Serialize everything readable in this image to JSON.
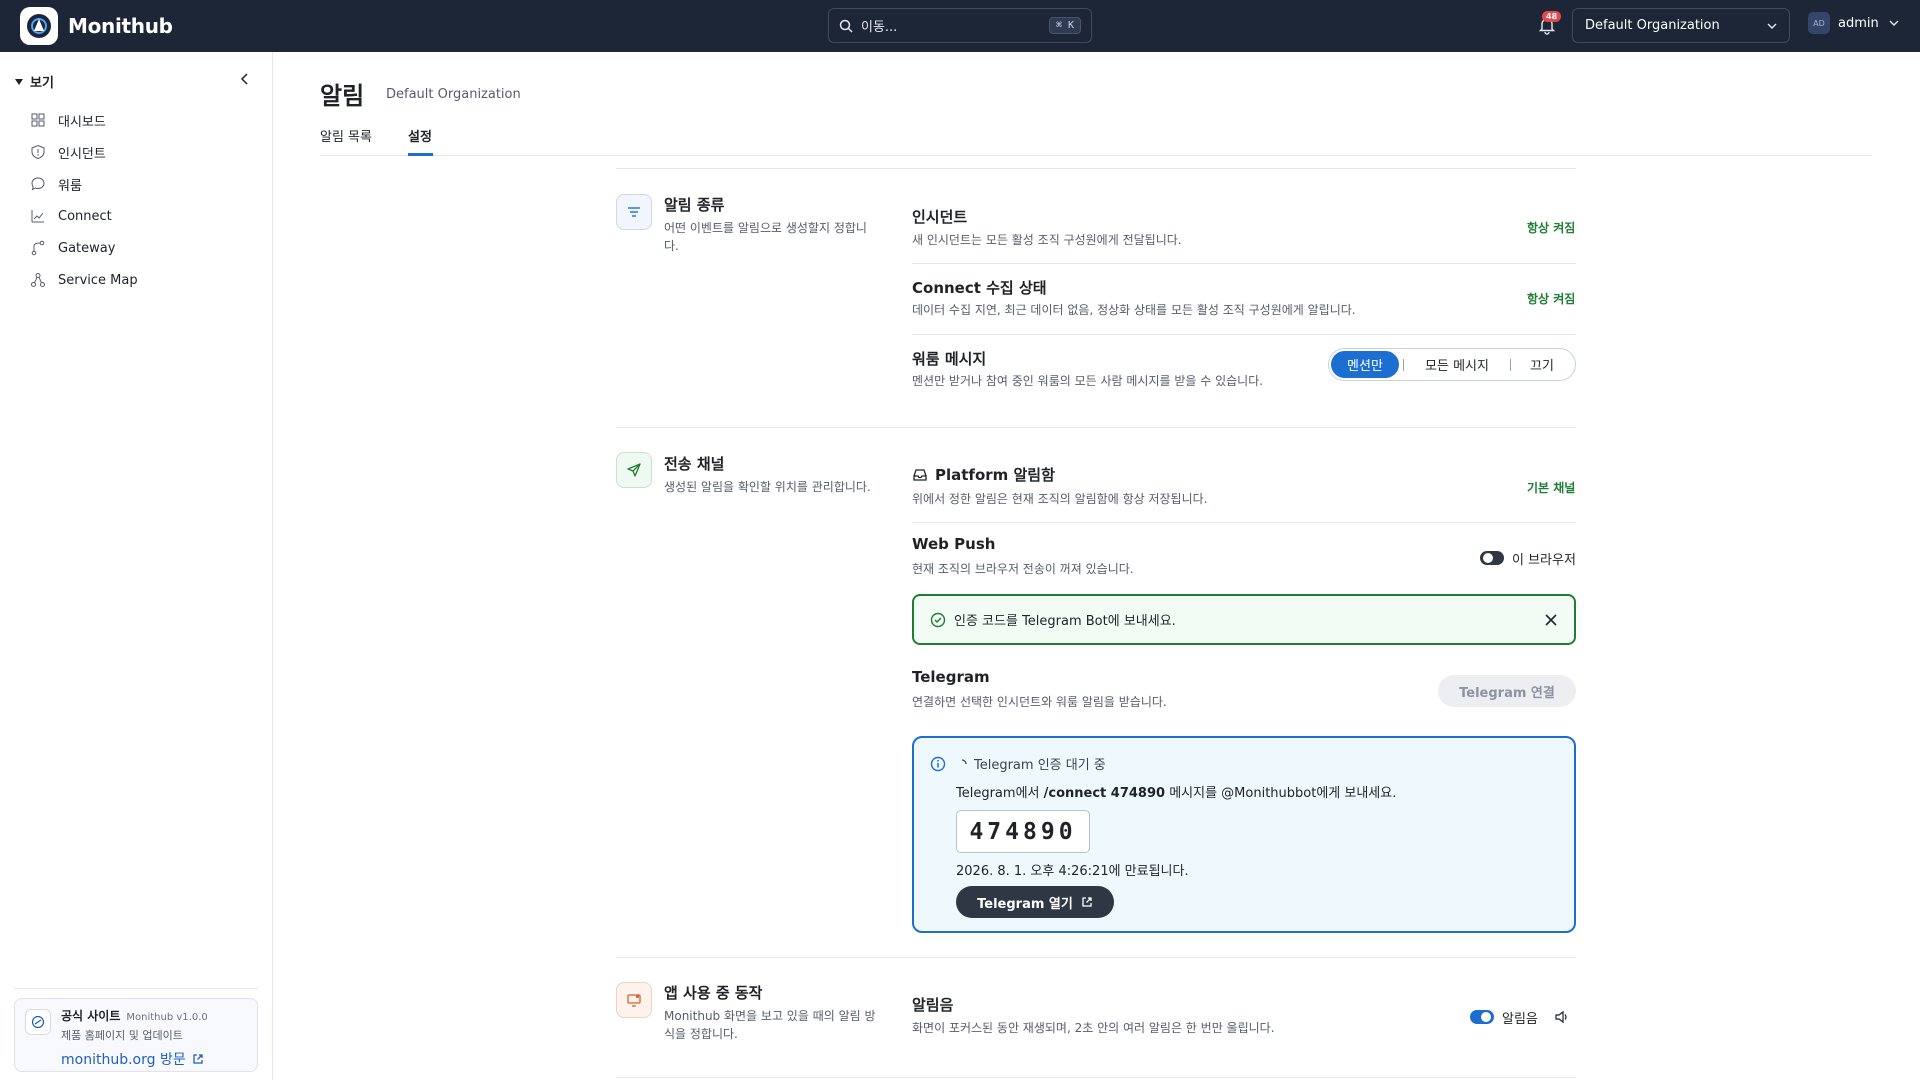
{
  "app": {
    "name": "Monithub"
  },
  "search": {
    "placeholder": "이동...",
    "shortcut": "⌘ K"
  },
  "notifications": {
    "count": "48"
  },
  "org_select": {
    "value": "Default Organization"
  },
  "user": {
    "initials": "AD",
    "name": "admin"
  },
  "sidebar": {
    "section_label": "보기",
    "items": [
      {
        "label": "대시보드",
        "icon": "dashboard-icon"
      },
      {
        "label": "인시던트",
        "icon": "incident-icon"
      },
      {
        "label": "워룸",
        "icon": "chat-icon"
      },
      {
        "label": "Connect",
        "icon": "connect-icon"
      },
      {
        "label": "Gateway",
        "icon": "gateway-icon"
      },
      {
        "label": "Service Map",
        "icon": "service-map-icon"
      }
    ],
    "footer": {
      "title": "공식 사이트",
      "version": "Monithub v1.0.0",
      "subtitle": "제품 홈페이지 및 업데이트",
      "link": "monithub.org 방문"
    }
  },
  "page": {
    "title": "알림",
    "subtitle": "Default Organization",
    "tabs": [
      {
        "label": "알림 목록",
        "active": false
      },
      {
        "label": "설정",
        "active": true
      }
    ]
  },
  "sections": {
    "types": {
      "title": "알림 종류",
      "desc": "어떤 이벤트를 알림으로 생성할지 정합니다.",
      "rows": {
        "incident": {
          "title": "인시던트",
          "desc": "새 인시던트는 모든 활성 조직 구성원에게 전달됩니다.",
          "status": "항상 켜짐"
        },
        "connect": {
          "title": "Connect 수집 상태",
          "desc": "데이터 수집 지연, 최근 데이터 없음, 정상화 상태를 모든 활성 조직 구성원에게 알립니다.",
          "status": "항상 켜짐"
        },
        "warroom": {
          "title": "워룸 메시지",
          "desc": "멘션만 받거나 참여 중인 워룸의 모든 사람 메시지를 받을 수 있습니다.",
          "options": [
            "멘션만",
            "모든 메시지",
            "끄기"
          ],
          "selected": "멘션만"
        }
      }
    },
    "channels": {
      "title": "전송 채널",
      "desc": "생성된 알림을 확인할 위치를 관리합니다.",
      "rows": {
        "inbox": {
          "title": "Platform 알림함",
          "desc": "위에서 정한 알림은 현재 조직의 알림함에 항상 저장됩니다.",
          "status": "기본 채널"
        },
        "webpush": {
          "title": "Web Push",
          "desc": "현재 조직의 브라우저 전송이 꺼져 있습니다.",
          "toggle_label": "이 브라우저",
          "enabled": false
        },
        "success_alert": "인증 코드를 Telegram Bot에 보내세요.",
        "telegram": {
          "title": "Telegram",
          "desc": "연결하면 선택한 인시던트와 워룸 알림을 받습니다.",
          "connect_button": "Telegram 연결",
          "pending": {
            "status": "Telegram 인증 대기 중",
            "instruction_pre": "Telegram에서 ",
            "command": "/connect 474890",
            "instruction_post": " 메시지를 @Monithubbot에게 보내세요.",
            "code": "474890",
            "expires": "2026. 8. 1. 오후 4:26:21에 만료됩니다.",
            "open_button": "Telegram 열기"
          }
        }
      }
    },
    "in_app": {
      "title": "앱 사용 중 동작",
      "desc": "Monithub 화면을 보고 있을 때의 알림 방식을 정합니다.",
      "rows": {
        "sound": {
          "title": "알림음",
          "desc": "화면이 포커스된 동안 재생되며, 2초 안의 여러 알림은 한 번만 울립니다.",
          "toggle_label": "알림음",
          "enabled": true
        }
      }
    }
  },
  "colors": {
    "accent": "#1c6fd1",
    "success": "#1e7e34",
    "topbar": "#1c2637"
  }
}
